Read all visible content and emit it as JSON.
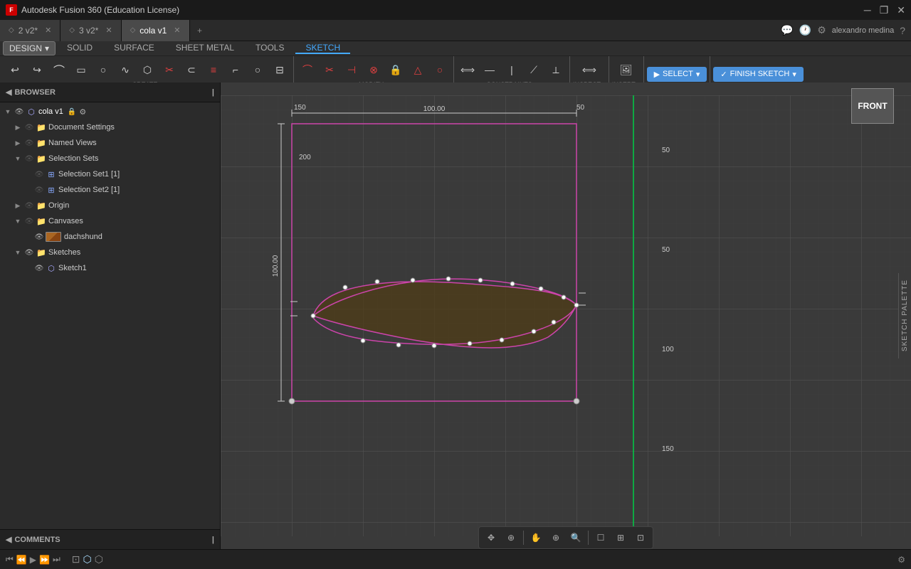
{
  "app": {
    "title": "Autodesk Fusion 360 (Education License)"
  },
  "titlebar": {
    "title": "Autodesk Fusion 360 (Education License)",
    "minimize": "─",
    "maximize": "❐",
    "close": "✕"
  },
  "tabs": [
    {
      "id": "tab1",
      "label": "2 v2*",
      "active": false,
      "closable": true
    },
    {
      "id": "tab2",
      "label": "3 v2*",
      "active": false,
      "closable": true
    },
    {
      "id": "tab3",
      "label": "cola v1",
      "active": true,
      "closable": true
    }
  ],
  "tabbar_right": {
    "user": "alexandro medina",
    "help_icon": "?",
    "notification_icon": "💬",
    "clock_icon": "🕐",
    "settings_icon": "⚙"
  },
  "toolbar": {
    "design_label": "DESIGN",
    "tabs": [
      "SOLID",
      "SURFACE",
      "SHEET METAL",
      "TOOLS",
      "SKETCH"
    ],
    "active_tab": "SKETCH",
    "sections": {
      "create": {
        "label": "CREATE",
        "tools": [
          "arc",
          "rect",
          "circle",
          "spline",
          "poly",
          "trim",
          "offset",
          "project",
          "line",
          "ellipse",
          "slot",
          "text",
          "mirror"
        ]
      },
      "modify": {
        "label": "MODIFY",
        "tools": [
          "fillet",
          "trim2",
          "extend",
          "break",
          "move",
          "scale"
        ]
      },
      "constraints": {
        "label": "CONSTRAINTS",
        "tools": [
          "coincident",
          "collinear",
          "concentric",
          "fix",
          "parallel",
          "perp",
          "tangent",
          "equal",
          "symmetric",
          "midpoint",
          "horizontal",
          "vertical"
        ]
      },
      "inspect": {
        "label": "INSPECT"
      },
      "insert": {
        "label": "INSERT"
      },
      "select": {
        "label": "SELECT",
        "active": true
      },
      "finish_sketch": {
        "label": "FINISH SKETCH"
      }
    }
  },
  "browser": {
    "header": "BROWSER",
    "tree": [
      {
        "level": 0,
        "label": "cola v1",
        "type": "component",
        "expanded": true,
        "visible": true,
        "locked": false,
        "settings": true
      },
      {
        "level": 1,
        "label": "Document Settings",
        "type": "folder",
        "expanded": false,
        "visible": false,
        "settings": false
      },
      {
        "level": 1,
        "label": "Named Views",
        "type": "folder",
        "expanded": false,
        "visible": false,
        "settings": false
      },
      {
        "level": 1,
        "label": "Selection Sets",
        "type": "folder",
        "expanded": true,
        "visible": false,
        "settings": false
      },
      {
        "level": 2,
        "label": "Selection Set1 [1]",
        "type": "selset",
        "expanded": false,
        "visible": false,
        "settings": false
      },
      {
        "level": 2,
        "label": "Selection Set2 [1]",
        "type": "selset",
        "expanded": false,
        "visible": false,
        "settings": false
      },
      {
        "level": 1,
        "label": "Origin",
        "type": "folder",
        "expanded": false,
        "visible": false,
        "settings": false
      },
      {
        "level": 1,
        "label": "Canvases",
        "type": "folder",
        "expanded": true,
        "visible": false,
        "settings": false
      },
      {
        "level": 2,
        "label": "dachshund",
        "type": "canvas",
        "expanded": false,
        "visible": true,
        "settings": false
      },
      {
        "level": 1,
        "label": "Sketches",
        "type": "folder",
        "expanded": true,
        "visible": true,
        "settings": false
      },
      {
        "level": 2,
        "label": "Sketch1",
        "type": "sketch",
        "expanded": false,
        "visible": true,
        "settings": false
      }
    ]
  },
  "canvas": {
    "view_label": "FRONT",
    "sketch_palette_label": "SKETCH PALETTE",
    "dim_top": "100.00",
    "dim_left_vertical": "100.00",
    "dim_right_top": "50",
    "ruler_200": "200",
    "ruler_150": "150",
    "ruler_100": "100",
    "ruler_50": "50"
  },
  "statusbar": {
    "comments_label": "COMMENTS",
    "playback_controls": [
      "⏮",
      "⏪",
      "▶",
      "⏩",
      "⏭"
    ]
  },
  "bottom_toolbar": {
    "tools": [
      "✥",
      "⊞",
      "✋",
      "⊕",
      "🔍",
      "☐",
      "⊟",
      "⊡"
    ]
  }
}
